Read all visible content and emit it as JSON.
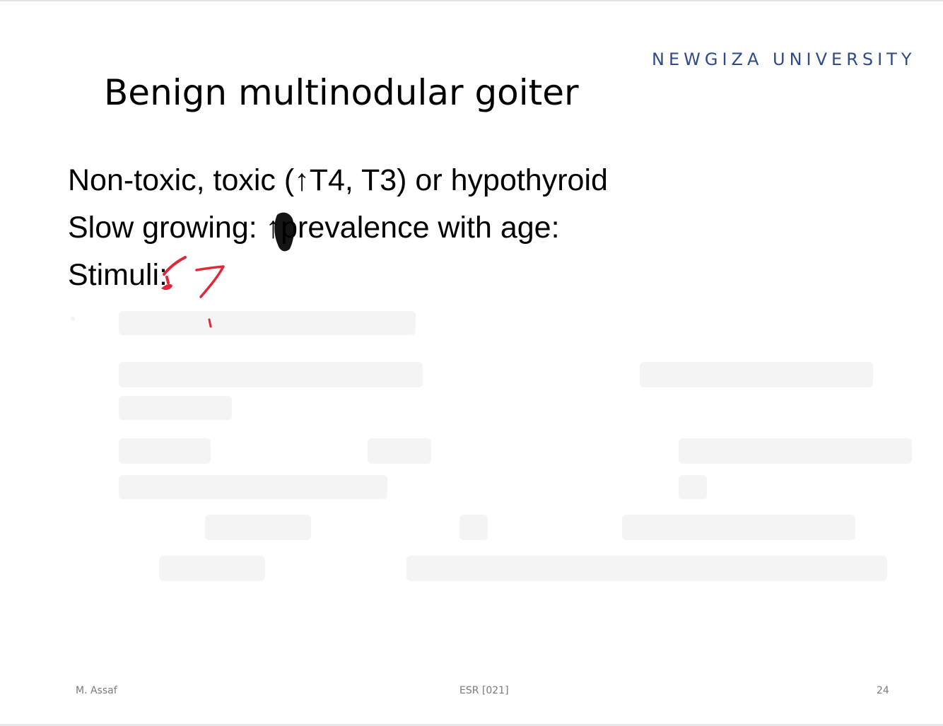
{
  "slide": {
    "university": "NEWGIZA UNIVERSITY",
    "title": "Benign multinodular goiter",
    "lines": [
      "Non-toxic, toxic (↑T4, T3) or hypothyroid",
      "Slow growing: ↑prevalence with age:",
      "Stimuli:"
    ],
    "page_number": "24"
  },
  "footer": {
    "left": "M. Assaf",
    "center": "ESR [021]"
  },
  "colors": {
    "university": "#2f4a8a",
    "ink_red": "#e0283a",
    "ink_black": "#000000"
  }
}
